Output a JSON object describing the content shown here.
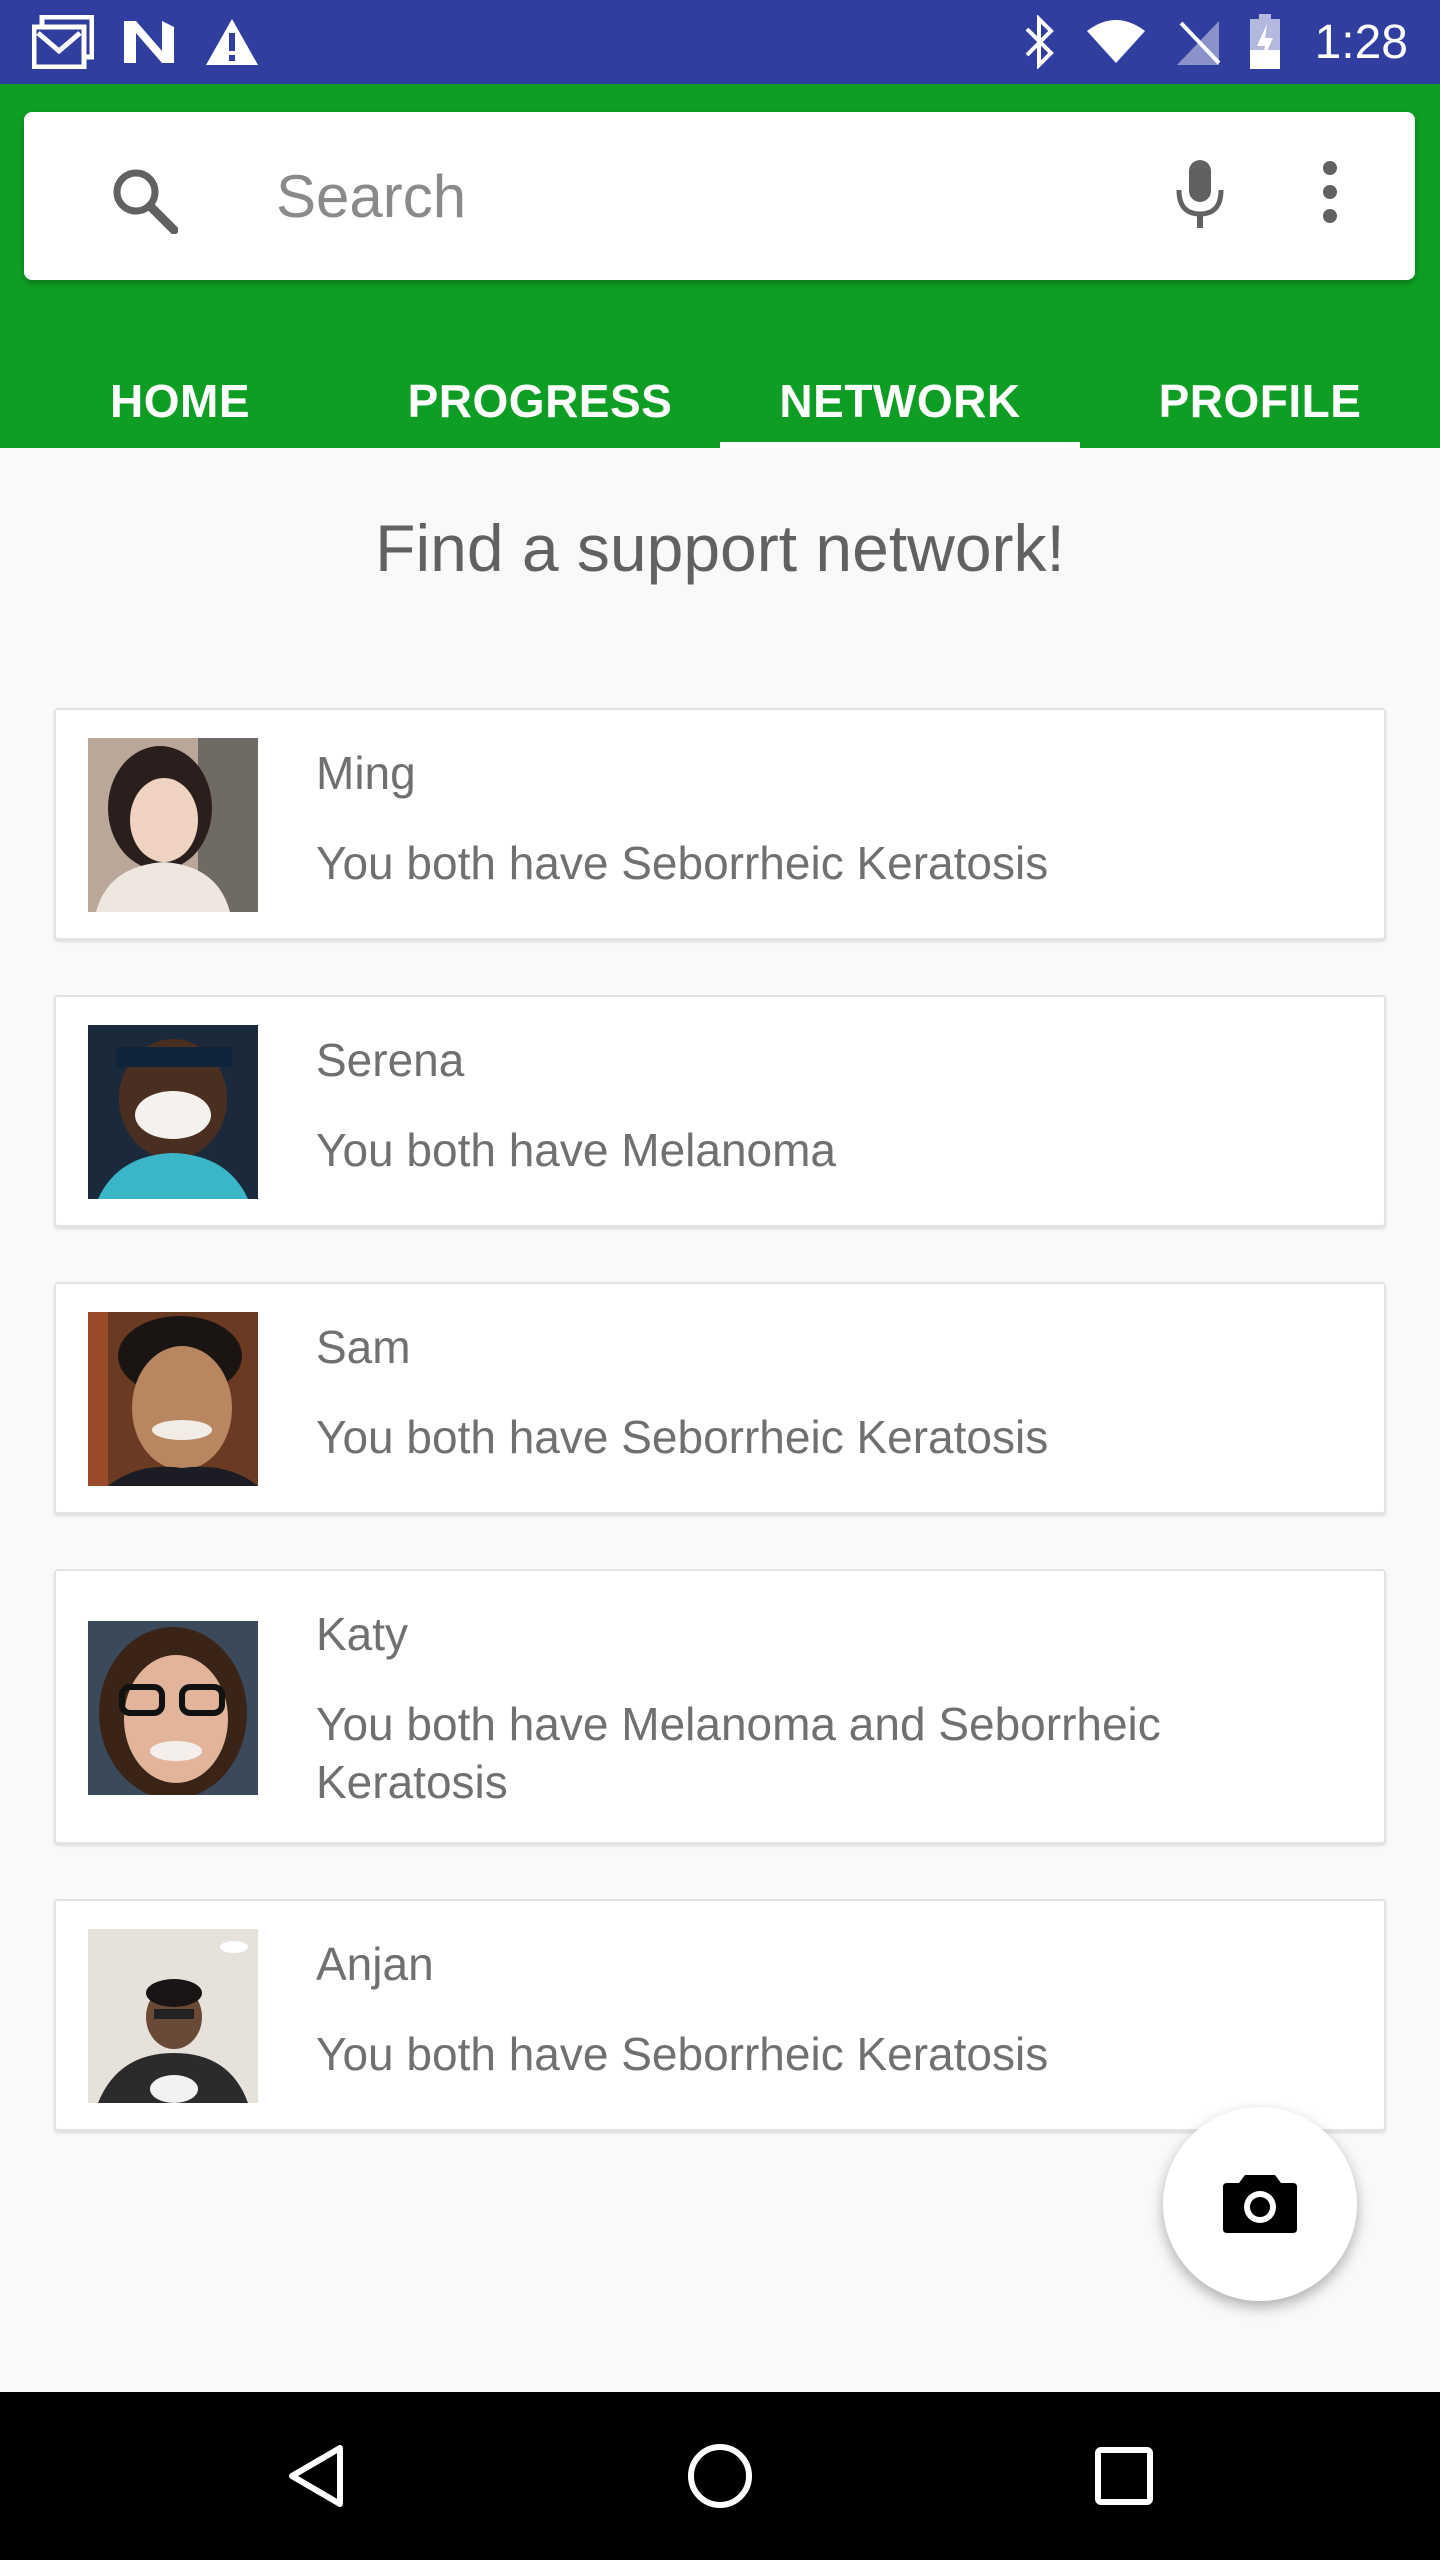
{
  "status_bar": {
    "time": "1:28",
    "left_icons": [
      "gmail-icon",
      "n-app-icon",
      "warning-icon"
    ],
    "right_icons": [
      "bluetooth-icon",
      "wifi-icon",
      "no-sim-icon",
      "battery-charging-icon"
    ]
  },
  "search": {
    "placeholder": "Search"
  },
  "tabs": [
    {
      "label": "HOME"
    },
    {
      "label": "PROGRESS"
    },
    {
      "label": "NETWORK"
    },
    {
      "label": "PROFILE"
    }
  ],
  "active_tab": "NETWORK",
  "heading": "Find a support network!",
  "matches": [
    {
      "name": "Ming",
      "condition": "You both have Seborrheic Keratosis"
    },
    {
      "name": "Serena",
      "condition": "You both have Melanoma"
    },
    {
      "name": "Sam",
      "condition": "You both have Seborrheic Keratosis"
    },
    {
      "name": "Katy",
      "condition": "You both have Melanoma and Seborrheic Keratosis"
    },
    {
      "name": "Anjan",
      "condition": "You both have Seborrheic Keratosis"
    }
  ],
  "fab": {
    "icon": "camera-icon"
  },
  "colors": {
    "status_bar": "#303f9f",
    "app_bar": "#0e9e23",
    "background": "#f9f9f9"
  }
}
